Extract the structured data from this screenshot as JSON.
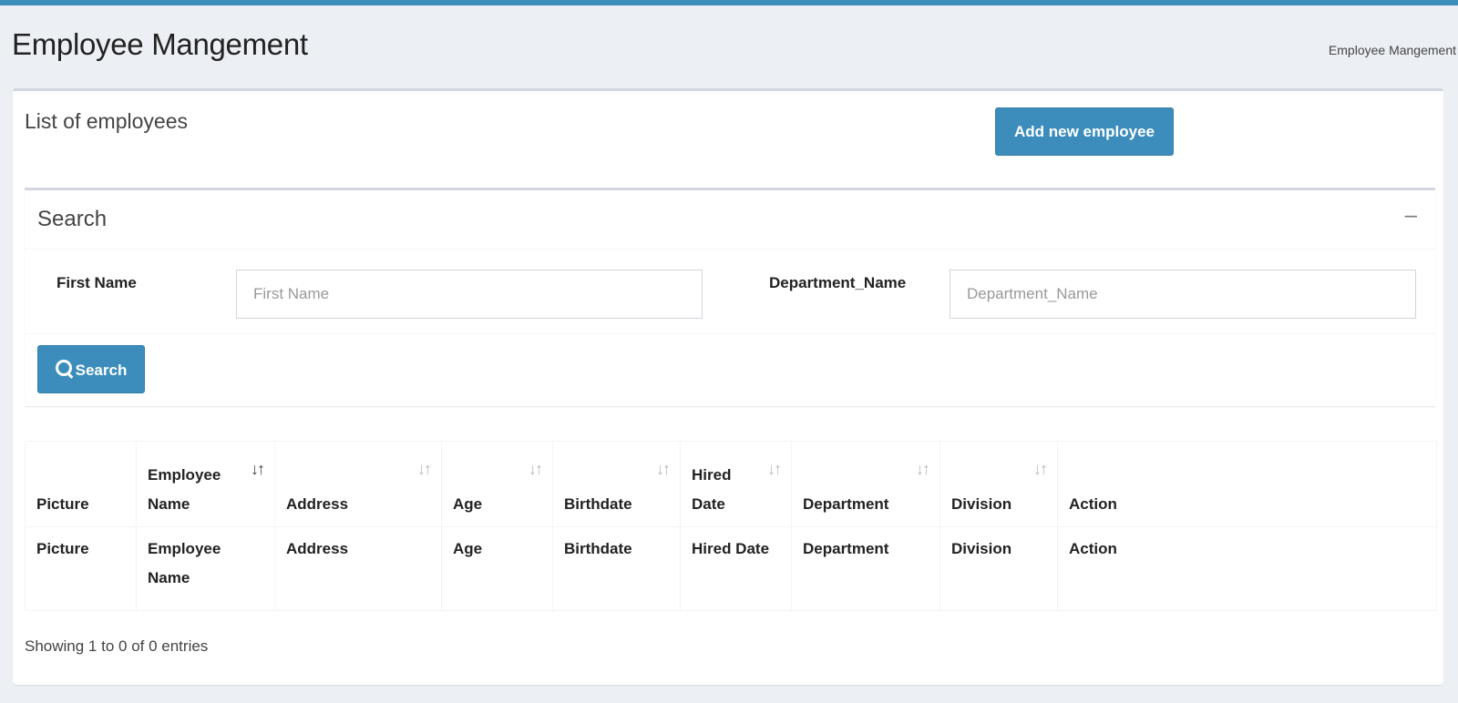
{
  "page": {
    "title": "Employee Mangement",
    "breadcrumb": "Employee Mangement"
  },
  "list_box": {
    "title": "List of employees",
    "add_button": "Add new employee"
  },
  "search": {
    "title": "Search",
    "collapse_icon": "minus-icon",
    "first_name_label": "First Name",
    "first_name_placeholder": "First Name",
    "first_name_value": "",
    "department_label": "Department_Name",
    "department_placeholder": "Department_Name",
    "department_value": "",
    "button_label": "Search",
    "button_icon": "search-icon"
  },
  "table": {
    "headers": [
      "Picture",
      "Employee Name",
      "Address",
      "Age",
      "Birthdate",
      "Hired Date",
      "Department",
      "Division",
      "Action"
    ],
    "sort_state": "Employee Name ascending",
    "footer_row": [
      "Picture",
      "Employee Name",
      "Address",
      "Age",
      "Birthdate",
      "Hired Date",
      "Department",
      "Division",
      "Action"
    ],
    "info": "Showing 1 to 0 of 0 entries"
  },
  "colors": {
    "accent": "#3c8dbc",
    "background": "#ecf0f5",
    "box_border": "#d2d6de"
  }
}
